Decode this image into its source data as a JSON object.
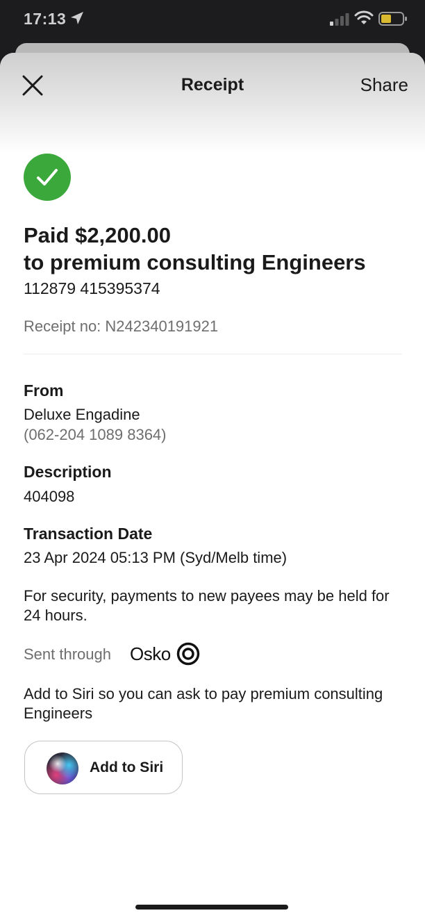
{
  "status_bar": {
    "time": "17:13",
    "icons": [
      "location-arrow-icon",
      "cellular-signal-icon",
      "wifi-icon",
      "battery-icon"
    ]
  },
  "header": {
    "title": "Receipt",
    "share_label": "Share",
    "close_icon": "close-icon"
  },
  "payment": {
    "status_icon": "check-icon",
    "status_color": "#3aa83a",
    "title_line1": "Paid $2,200.00",
    "title_line2": "to premium consulting Engineers",
    "account": "112879 415395374",
    "receipt_no": "Receipt no: N242340191921"
  },
  "details": {
    "from_label": "From",
    "from_name": "Deluxe Engadine",
    "from_account": "(062-204 1089 8364)",
    "description_label": "Description",
    "description_value": "404098",
    "date_label": "Transaction Date",
    "date_value": "23 Apr 2024 05:13 PM (Syd/Melb time)"
  },
  "notice": "For security, payments to new payees may be held for 24 hours.",
  "sent_through": {
    "label": "Sent through",
    "brand": "Osko",
    "brand_icon": "osko-logo-icon"
  },
  "siri": {
    "prompt": "Add to Siri so you can ask to pay premium consulting Engineers",
    "button_label": "Add to Siri",
    "icon": "siri-orb-icon"
  }
}
